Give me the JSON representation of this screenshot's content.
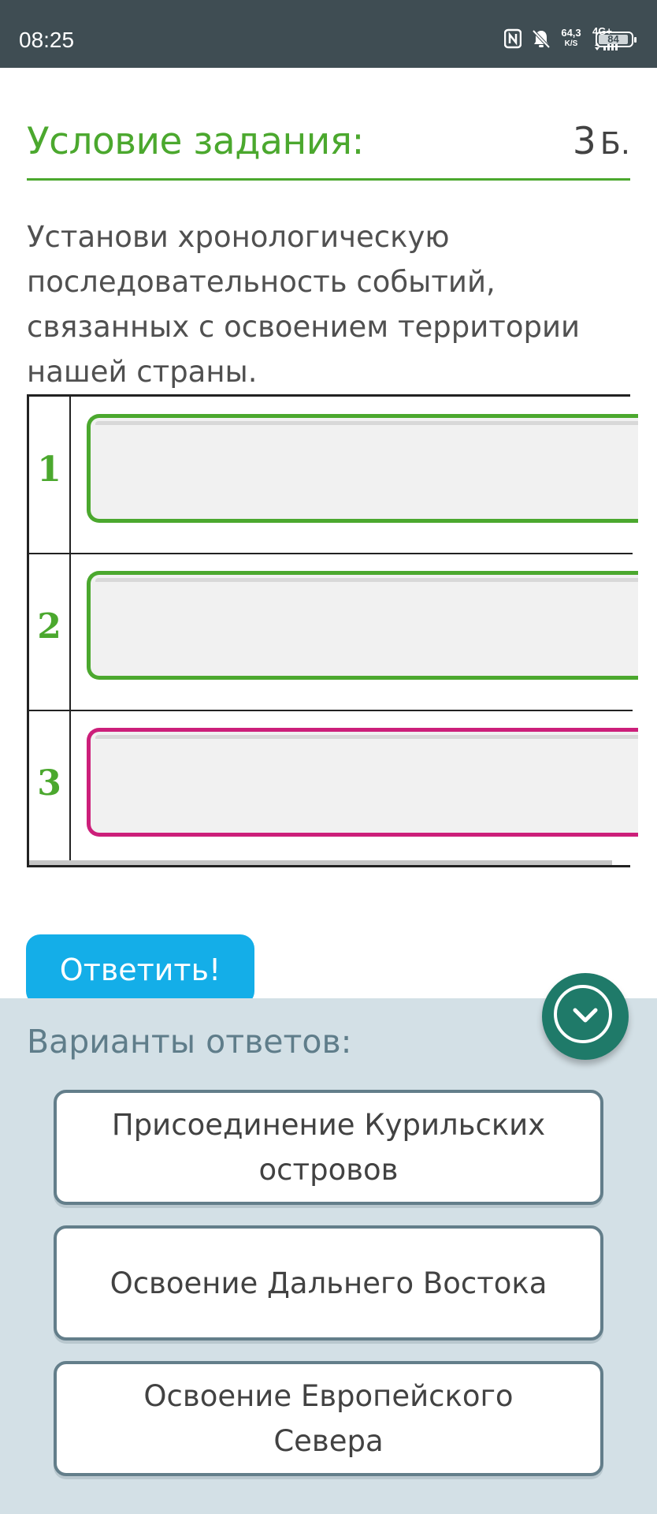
{
  "status_bar": {
    "time": "08:25",
    "net_speed_value": "64,3",
    "net_speed_unit": "K/S",
    "network_type": "4G+",
    "battery_level": "84",
    "icons": [
      "nfc-icon",
      "bell-off-icon",
      "signal-icon",
      "battery-icon"
    ]
  },
  "task": {
    "title": "Условие задания:",
    "points_value": "3",
    "points_unit": "Б.",
    "text": "Установи хронологическую последовательность событий, связанных с освоением территории нашей страны."
  },
  "answer_slots": [
    {
      "number": "1",
      "state": "empty"
    },
    {
      "number": "2",
      "state": "empty"
    },
    {
      "number": "3",
      "state": "empty-active"
    }
  ],
  "submit": {
    "label": "Ответить!"
  },
  "options": {
    "title": "Варианты ответов:",
    "items": [
      {
        "label": "Присоединение Курильских островов"
      },
      {
        "label": "Освоение Дальнего Востока"
      },
      {
        "label": "Освоение Европейского Севера"
      }
    ]
  },
  "colors": {
    "accent_green": "#4ba82e",
    "active_slot": "#cc1f7a",
    "submit_blue": "#14aee8",
    "panel_bg": "#d3e0e6",
    "fab_teal": "#1f7a69",
    "status_bar": "#3f4d53"
  }
}
